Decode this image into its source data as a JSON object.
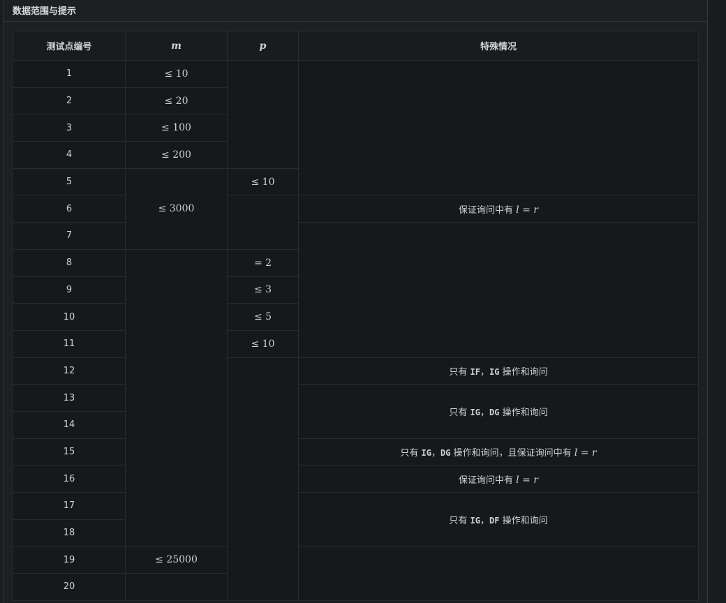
{
  "section_title": "数据范围与提示",
  "headers": {
    "id": "测试点编号",
    "m": "m",
    "p": "p",
    "special": "特殊情况"
  },
  "row_ids": [
    "1",
    "2",
    "3",
    "4",
    "5",
    "6",
    "7",
    "8",
    "9",
    "10",
    "11",
    "12",
    "13",
    "14",
    "15",
    "16",
    "17",
    "18",
    "19",
    "20"
  ],
  "m_cells": {
    "r1": "10",
    "r2": "20",
    "r3": "100",
    "r4": "200",
    "r5": "3000",
    "r19": "25000"
  },
  "p_cells": {
    "r5": "10",
    "r8": "2",
    "r9": "3",
    "r10": "5",
    "r11": "10"
  },
  "symbols": {
    "le": "≤",
    "eq": "="
  },
  "special": {
    "r6": {
      "text": "保证询问中有",
      "l": "l",
      "eq": "=",
      "r": "r"
    },
    "r12": {
      "pre": "只有 ",
      "op1": "IF",
      "sep": "，",
      "op2": "IG",
      "post": " 操作和询问"
    },
    "r13": {
      "pre": "只有 ",
      "op1": "IG",
      "sep": "，",
      "op2": "DG",
      "post": " 操作和询问"
    },
    "r15": {
      "pre": "只有 ",
      "op1": "IG",
      "sep": "，",
      "op2": "DG",
      "post": " 操作和询问，且保证询问中有",
      "l": "l",
      "eq": "=",
      "r": "r"
    },
    "r16": {
      "text": "保证询问中有",
      "l": "l",
      "eq": "=",
      "r": "r"
    },
    "r17": {
      "pre": "只有 ",
      "op1": "IG",
      "sep": "，",
      "op2": "DF",
      "post": " 操作和询问"
    }
  }
}
